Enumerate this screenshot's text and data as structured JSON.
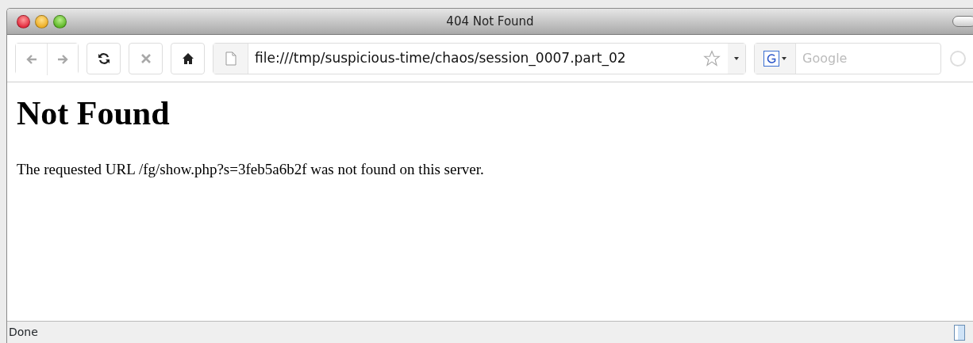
{
  "window": {
    "title": "404 Not Found"
  },
  "toolbar": {
    "buttons": [
      {
        "kind": "back",
        "disabled": true
      },
      {
        "kind": "forward",
        "disabled": true
      },
      {
        "kind": "reload",
        "disabled": false
      },
      {
        "kind": "stop",
        "disabled": true
      },
      {
        "kind": "home",
        "disabled": false
      }
    ],
    "address": {
      "value": "file:///tmp/suspicious-time/chaos/session_0007.part_02"
    },
    "search": {
      "placeholder": "Google"
    }
  },
  "page": {
    "heading": "Not Found",
    "message": "The requested URL /fg/show.php?s=3feb5a6b2f was not found on this server."
  },
  "status_bar": {
    "text": "Done"
  }
}
